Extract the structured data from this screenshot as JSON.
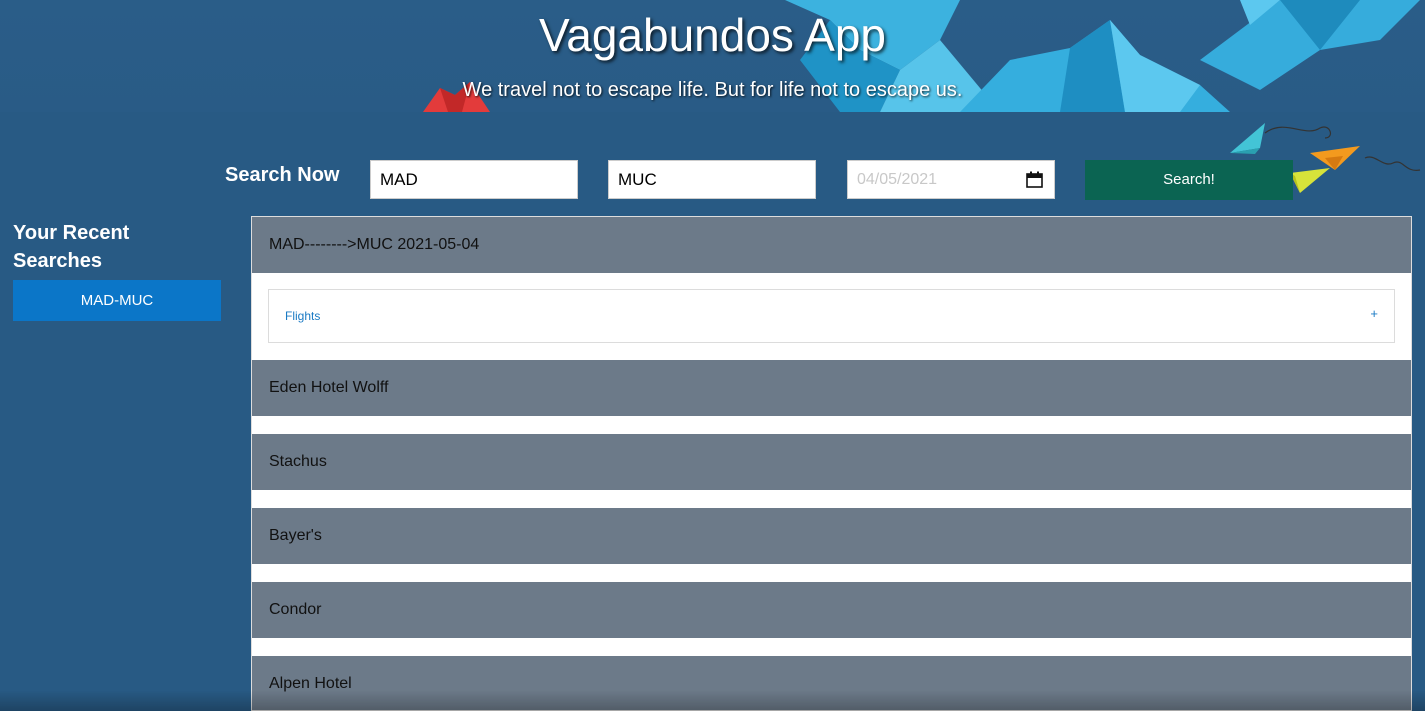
{
  "header": {
    "title": "Vagabundos App",
    "subtitle": "We travel not to escape life. But for life not to escape us."
  },
  "search": {
    "label": "Search Now",
    "origin_value": "MAD",
    "destination_value": "MUC",
    "date_value": "04/05/2021",
    "button_label": "Search!"
  },
  "sidebar": {
    "title": "Your Recent Searches",
    "items": [
      {
        "label": "MAD-MUC"
      }
    ]
  },
  "results": {
    "route_header": "MAD-------->MUC 2021-05-04",
    "flights_panel": {
      "label": "Flights",
      "toggle": "+"
    },
    "hotels": [
      {
        "name": "Eden Hotel Wolff"
      },
      {
        "name": "Stachus"
      },
      {
        "name": "Bayer's"
      },
      {
        "name": "Condor"
      },
      {
        "name": "Alpen Hotel"
      }
    ]
  },
  "icons": {
    "date_picker": "calendar-icon"
  },
  "colors": {
    "background": "#285a84",
    "search_button": "#0b6452",
    "recent_item": "#0b76c8",
    "result_row": "#6c7a89",
    "flights_link": "#1a7ac4"
  }
}
